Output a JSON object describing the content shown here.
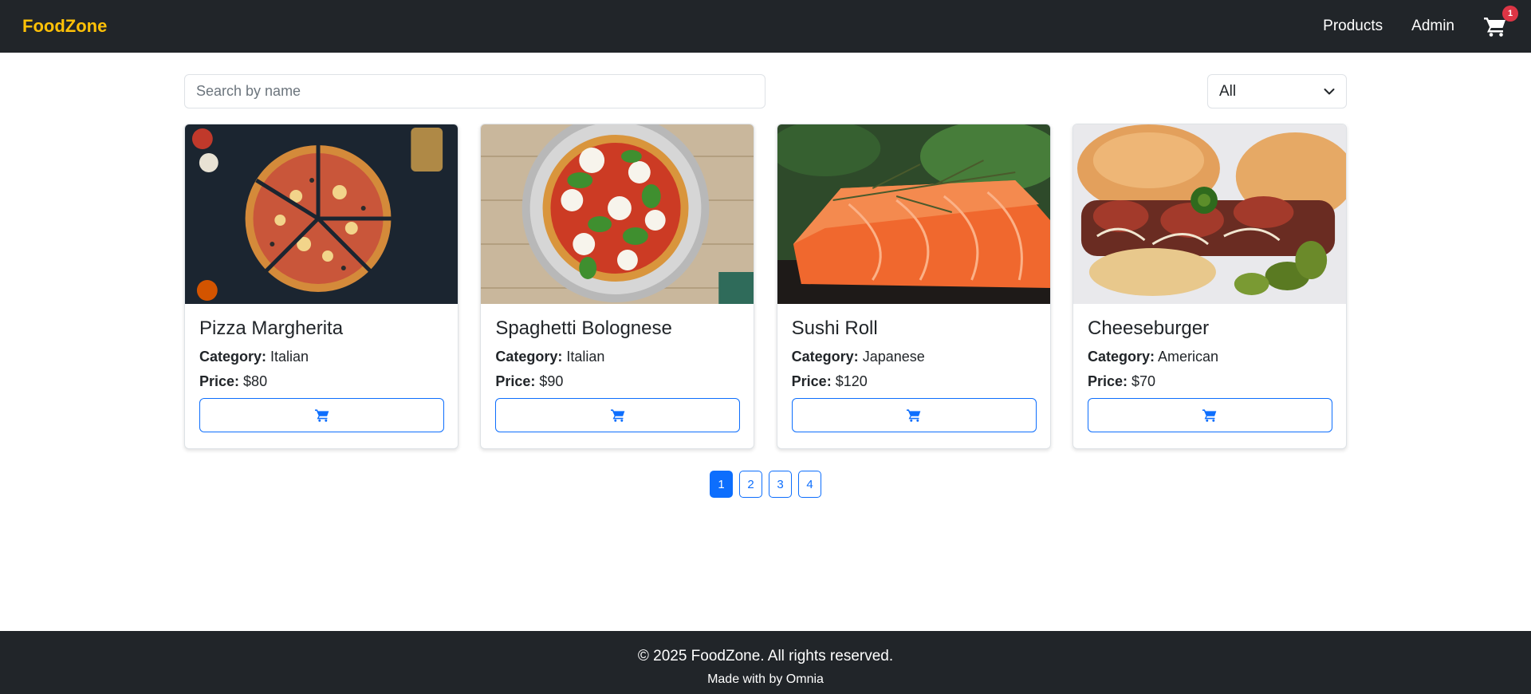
{
  "navbar": {
    "brand": "FoodZone",
    "links": [
      "Products",
      "Admin"
    ],
    "cart_icon": "cart-icon",
    "cart_count": "1"
  },
  "filters": {
    "search_placeholder": "Search by name",
    "search_value": "",
    "category_selected": "All"
  },
  "products": [
    {
      "name": "Pizza Margherita",
      "category_label": "Category:",
      "category": "Italian",
      "price_label": "Price:",
      "price": "$80"
    },
    {
      "name": "Spaghetti Bolognese",
      "category_label": "Category:",
      "category": "Italian",
      "price_label": "Price:",
      "price": "$90"
    },
    {
      "name": "Sushi Roll",
      "category_label": "Category:",
      "category": "Japanese",
      "price_label": "Price:",
      "price": "$120"
    },
    {
      "name": "Cheeseburger",
      "category_label": "Category:",
      "category": "American",
      "price_label": "Price:",
      "price": "$70"
    }
  ],
  "pagination": {
    "pages": [
      "1",
      "2",
      "3",
      "4"
    ],
    "current": "1"
  },
  "footer": {
    "copyright": "© 2025 FoodZone. All rights reserved.",
    "made_with": "Made with by Omnia"
  },
  "colors": {
    "navbar_bg": "#212529",
    "brand": "#ffc107",
    "primary": "#0d6efd",
    "badge": "#dc3545"
  }
}
